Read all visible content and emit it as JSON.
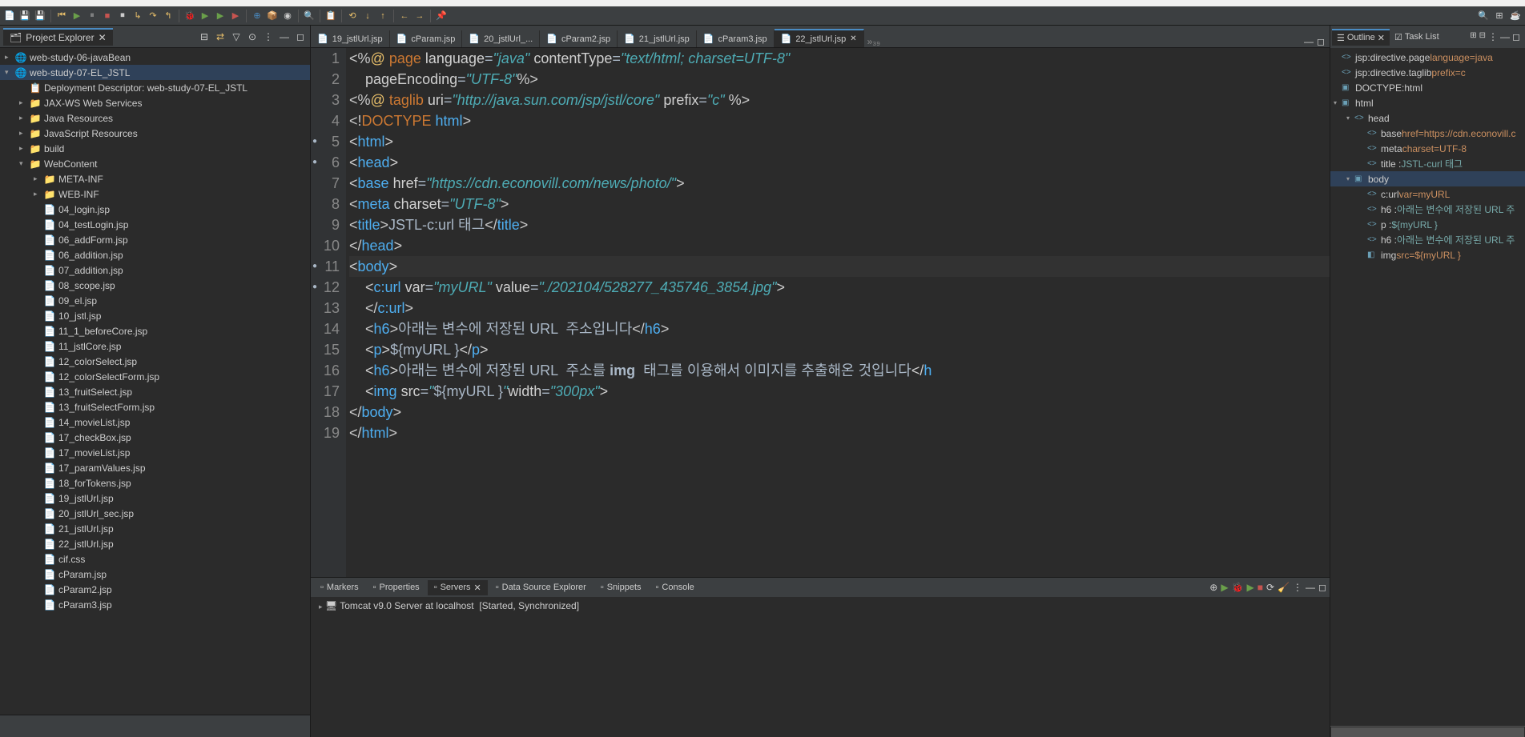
{
  "projectExplorer": {
    "title": "Project Explorer",
    "projects": [
      {
        "name": "web-study-06-javaBean",
        "expanded": false
      },
      {
        "name": "web-study-07-EL_JSTL",
        "expanded": true,
        "children": [
          {
            "name": "Deployment Descriptor: web-study-07-EL_JSTL",
            "indent": 1,
            "type": "deploy"
          },
          {
            "name": "JAX-WS Web Services",
            "indent": 1,
            "type": "folder",
            "expandable": true
          },
          {
            "name": "Java Resources",
            "indent": 1,
            "type": "folder",
            "expandable": true
          },
          {
            "name": "JavaScript Resources",
            "indent": 1,
            "type": "folder",
            "expandable": true
          },
          {
            "name": "build",
            "indent": 1,
            "type": "folder",
            "expandable": true
          },
          {
            "name": "WebContent",
            "indent": 1,
            "type": "folder",
            "expandable": true,
            "expanded": true
          },
          {
            "name": "META-INF",
            "indent": 2,
            "type": "folder",
            "expandable": true
          },
          {
            "name": "WEB-INF",
            "indent": 2,
            "type": "folder",
            "expandable": true
          },
          {
            "name": "04_login.jsp",
            "indent": 2,
            "type": "file"
          },
          {
            "name": "04_testLogin.jsp",
            "indent": 2,
            "type": "file"
          },
          {
            "name": "06_addForm.jsp",
            "indent": 2,
            "type": "file"
          },
          {
            "name": "06_addition.jsp",
            "indent": 2,
            "type": "file"
          },
          {
            "name": "07_addition.jsp",
            "indent": 2,
            "type": "file"
          },
          {
            "name": "08_scope.jsp",
            "indent": 2,
            "type": "file"
          },
          {
            "name": "09_el.jsp",
            "indent": 2,
            "type": "file"
          },
          {
            "name": "10_jstl.jsp",
            "indent": 2,
            "type": "file"
          },
          {
            "name": "11_1_beforeCore.jsp",
            "indent": 2,
            "type": "file"
          },
          {
            "name": "11_jstlCore.jsp",
            "indent": 2,
            "type": "file"
          },
          {
            "name": "12_colorSelect.jsp",
            "indent": 2,
            "type": "file"
          },
          {
            "name": "12_colorSelectForm.jsp",
            "indent": 2,
            "type": "file"
          },
          {
            "name": "13_fruitSelect.jsp",
            "indent": 2,
            "type": "file"
          },
          {
            "name": "13_fruitSelectForm.jsp",
            "indent": 2,
            "type": "file"
          },
          {
            "name": "14_movieList.jsp",
            "indent": 2,
            "type": "file"
          },
          {
            "name": "17_checkBox.jsp",
            "indent": 2,
            "type": "file"
          },
          {
            "name": "17_movieList.jsp",
            "indent": 2,
            "type": "file"
          },
          {
            "name": "17_paramValues.jsp",
            "indent": 2,
            "type": "file"
          },
          {
            "name": "18_forTokens.jsp",
            "indent": 2,
            "type": "file"
          },
          {
            "name": "19_jstlUrl.jsp",
            "indent": 2,
            "type": "file"
          },
          {
            "name": "20_jstlUrl_sec.jsp",
            "indent": 2,
            "type": "file"
          },
          {
            "name": "21_jstlUrl.jsp",
            "indent": 2,
            "type": "file"
          },
          {
            "name": "22_jstlUrl.jsp",
            "indent": 2,
            "type": "file"
          },
          {
            "name": "cif.css",
            "indent": 2,
            "type": "file"
          },
          {
            "name": "cParam.jsp",
            "indent": 2,
            "type": "file"
          },
          {
            "name": "cParam2.jsp",
            "indent": 2,
            "type": "file"
          },
          {
            "name": "cParam3.jsp",
            "indent": 2,
            "type": "file"
          }
        ]
      }
    ]
  },
  "editorTabs": [
    {
      "name": "19_jstlUrl.jsp"
    },
    {
      "name": "cParam.jsp"
    },
    {
      "name": "20_jstlUrl_..."
    },
    {
      "name": "cParam2.jsp"
    },
    {
      "name": "21_jstlUrl.jsp"
    },
    {
      "name": "cParam3.jsp"
    },
    {
      "name": "22_jstlUrl.jsp",
      "active": true
    }
  ],
  "editorTabsOverflow": "»₃₉",
  "codeLines": [
    {
      "n": "1",
      "html": "<span class='tag-br'>&lt;%</span><span class='directive'>@</span> <span class='keyword'>page</span> <span class='attr-name'>language</span><span class='attr-eq'>=</span><span class='str2'>\"java\"</span> <span class='attr-name'>contentType</span><span class='attr-eq'>=</span><span class='str2'>\"text/html; charset=UTF-8\"</span>"
    },
    {
      "n": "2",
      "html": "    <span class='attr-name'>pageEncoding</span><span class='attr-eq'>=</span><span class='str2'>\"UTF-8\"</span><span class='tag-br'>%&gt;</span>"
    },
    {
      "n": "3",
      "html": "<span class='tag-br'>&lt;%</span><span class='directive'>@</span> <span class='keyword'>taglib</span> <span class='attr-name'>uri</span><span class='attr-eq'>=</span><span class='str2'>\"http://java.sun.com/jsp/jstl/core\"</span> <span class='attr-name'>prefix</span><span class='attr-eq'>=</span><span class='str2'>\"c\"</span> <span class='tag-br'>%&gt;</span>"
    },
    {
      "n": "4",
      "html": "<span class='tag-br'>&lt;!</span><span class='keyword'>DOCTYPE</span> <span class='tagname'>html</span><span class='tag-br'>&gt;</span>"
    },
    {
      "n": "5",
      "mark": "●",
      "html": "<span class='tag-br'>&lt;</span><span class='tagname'>html</span><span class='tag-br'>&gt;</span>"
    },
    {
      "n": "6",
      "mark": "●",
      "html": "<span class='tag-br'>&lt;</span><span class='tagname'>head</span><span class='tag-br'>&gt;</span>"
    },
    {
      "n": "7",
      "html": "<span class='tag-br'>&lt;</span><span class='tagname'>base</span> <span class='attr-name'>href</span><span class='attr-eq'>=</span><span class='str2'>\"https://cdn.econovill.com/news/photo/\"</span><span class='tag-br'>&gt;</span>"
    },
    {
      "n": "8",
      "html": "<span class='tag-br'>&lt;</span><span class='tagname'>meta</span> <span class='attr-name'>charset</span><span class='attr-eq'>=</span><span class='str2'>\"UTF-8\"</span><span class='tag-br'>&gt;</span>"
    },
    {
      "n": "9",
      "html": "<span class='tag-br'>&lt;</span><span class='tagname'>title</span><span class='tag-br'>&gt;</span>JSTL-c:url 태그<span class='tag-br'>&lt;/</span><span class='tagname'>title</span><span class='tag-br'>&gt;</span>"
    },
    {
      "n": "10",
      "html": "<span class='tag-br'>&lt;/</span><span class='tagname'>head</span><span class='tag-br'>&gt;</span>"
    },
    {
      "n": "11",
      "mark": "●",
      "current": true,
      "html": "<span class='tag-br'>&lt;</span><span class='tagname'>body</span><span class='tag-br'>&gt;</span>"
    },
    {
      "n": "12",
      "mark": "●",
      "html": "    <span class='tag-br'>&lt;</span><span class='tagname'>c:url</span> <span class='attr-name'>var</span><span class='attr-eq'>=</span><span class='str2'>\"myURL\"</span> <span class='attr-name'>value</span><span class='attr-eq'>=</span><span class='str2'>\"./202104/528277_435746_3854.jpg\"</span><span class='tag-br'>&gt;</span>"
    },
    {
      "n": "13",
      "html": "    <span class='tag-br'>&lt;/</span><span class='tagname'>c:url</span><span class='tag-br'>&gt;</span>"
    },
    {
      "n": "14",
      "html": "    <span class='tag-br'>&lt;</span><span class='tagname'>h6</span><span class='tag-br'>&gt;</span>아래는 변수에 저장된 URL  주소입니다<span class='tag-br'>&lt;/</span><span class='tagname'>h6</span><span class='tag-br'>&gt;</span>"
    },
    {
      "n": "15",
      "html": "    <span class='tag-br'>&lt;</span><span class='tagname'>p</span><span class='tag-br'>&gt;</span>${myURL }<span class='tag-br'>&lt;/</span><span class='tagname'>p</span><span class='tag-br'>&gt;</span>"
    },
    {
      "n": "16",
      "html": "    <span class='tag-br'>&lt;</span><span class='tagname'>h6</span><span class='tag-br'>&gt;</span>아래는 변수에 저장된 URL  주소를 <span style='font-weight:bold'>img</span>  태그를 이용해서 이미지를 추출해온 것입니다<span class='tag-br'>&lt;/</span><span class='tagname'>h</span>"
    },
    {
      "n": "17",
      "html": "    <span class='tag-br'>&lt;</span><span class='tagname'>img</span> <span class='attr-name'>src</span><span class='attr-eq'>=</span><span class='str2'>\"</span>${myURL }<span class='str2'>\"</span><span class='attr-name'>width</span><span class='attr-eq'>=</span><span class='str2'>\"300px\"</span><span class='tag-br'>&gt;</span>"
    },
    {
      "n": "18",
      "html": "<span class='tag-br'>&lt;/</span><span class='tagname'>body</span><span class='tag-br'>&gt;</span>"
    },
    {
      "n": "19",
      "html": "<span class='tag-br'>&lt;/</span><span class='tagname'>html</span><span class='tag-br'>&gt;</span>"
    }
  ],
  "bottomTabs": [
    {
      "name": "Markers"
    },
    {
      "name": "Properties"
    },
    {
      "name": "Servers",
      "active": true
    },
    {
      "name": "Data Source Explorer"
    },
    {
      "name": "Snippets"
    },
    {
      "name": "Console"
    }
  ],
  "server": {
    "name": "Tomcat v9.0 Server at localhost",
    "status": "[Started, Synchronized]"
  },
  "outline": {
    "title": "Outline",
    "tasklist": "Task List",
    "items": [
      {
        "indent": 0,
        "icon": "<>",
        "text": "jsp:directive.page",
        "attr": "language=java"
      },
      {
        "indent": 0,
        "icon": "<>",
        "text": "jsp:directive.taglib",
        "attr": "prefix=c"
      },
      {
        "indent": 0,
        "icon": "▣",
        "text": "DOCTYPE:html"
      },
      {
        "indent": 0,
        "icon": "▣",
        "expander": "▾",
        "text": "html"
      },
      {
        "indent": 1,
        "icon": "<>",
        "expander": "▾",
        "text": "head"
      },
      {
        "indent": 2,
        "icon": "<>",
        "text": "base",
        "attr": "href=https://cdn.econovill.c"
      },
      {
        "indent": 2,
        "icon": "<>",
        "text": "meta",
        "attr": "charset=UTF-8"
      },
      {
        "indent": 2,
        "icon": "<>",
        "text": "title :",
        "attr": "JSTL-curl 태그",
        "attrColor": "#7aa"
      },
      {
        "indent": 1,
        "icon": "▣",
        "expander": "▾",
        "text": "body",
        "selected": true
      },
      {
        "indent": 2,
        "icon": "<>",
        "text": "c:url",
        "attr": "var=myURL"
      },
      {
        "indent": 2,
        "icon": "<>",
        "text": "h6 :",
        "attr": "아래는 변수에 저장된 URL 주",
        "attrColor": "#7aa"
      },
      {
        "indent": 2,
        "icon": "<>",
        "text": "p :",
        "attr": "${myURL }",
        "attrColor": "#7aa"
      },
      {
        "indent": 2,
        "icon": "<>",
        "text": "h6 :",
        "attr": "아래는 변수에 저장된 URL 주",
        "attrColor": "#7aa"
      },
      {
        "indent": 2,
        "icon": "◧",
        "text": "img",
        "attr": "src=${myURL }"
      }
    ]
  }
}
